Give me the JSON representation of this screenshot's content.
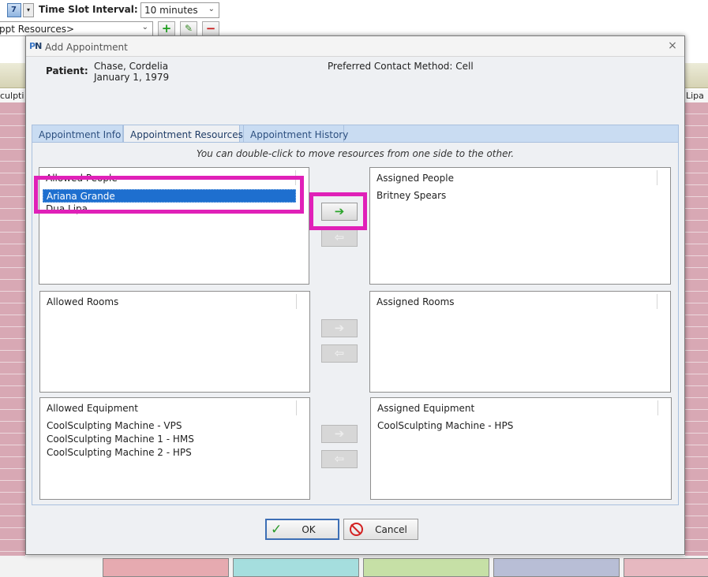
{
  "background": {
    "toolbar": {
      "time_slot_label": "Time Slot Interval:",
      "time_slot_value": "10 minutes",
      "resources_select_value": "ppt Resources>",
      "caret": "⌄",
      "calendar_dropdown": "▾",
      "add_glyph": "+",
      "edit_glyph": "✎",
      "delete_glyph": "−"
    },
    "columns": [
      {
        "label": "culpti",
        "color": "#d8a8b4"
      },
      {
        "label": "Lipa",
        "color": "#d8a8b4"
      }
    ],
    "bottom_bars": [
      "#e6aab0",
      "#a5dede",
      "#c6e0a6",
      "#b8bed6",
      "#e6b8c0"
    ]
  },
  "dialog": {
    "logo": {
      "p": "P",
      "n": "N"
    },
    "title": "Add Appointment",
    "close_glyph": "×",
    "patient": {
      "label": "Patient:",
      "name": "Chase, Cordelia",
      "dob": "January 1, 1979",
      "contact": "Preferred Contact Method: Cell"
    },
    "tabs": [
      {
        "label": "Appointment Info",
        "active": false
      },
      {
        "label": "Appointment Resources",
        "active": true
      },
      {
        "label": "Appointment History",
        "active": false
      }
    ],
    "hint": "You can double-click to move resources from one side to the other.",
    "allowed_people": {
      "header": "Allowed People",
      "items": [
        "Ariana Grande",
        "Dua Lipa"
      ],
      "selected": "Ariana Grande"
    },
    "assigned_people": {
      "header": "Assigned People",
      "items": [
        "Britney Spears"
      ]
    },
    "allowed_rooms": {
      "header": "Allowed Rooms",
      "items": []
    },
    "assigned_rooms": {
      "header": "Assigned Rooms",
      "items": []
    },
    "allowed_equipment": {
      "header": "Allowed Equipment",
      "items": [
        "CoolSculpting Machine - VPS",
        "CoolSculpting Machine 1 - HMS",
        "CoolSculpting Machine 2 - HPS"
      ]
    },
    "assigned_equipment": {
      "header": "Assigned Equipment",
      "items": [
        "CoolSculpting Machine - HPS"
      ]
    },
    "arrows": {
      "right": "➔",
      "left": "⇦"
    },
    "ok_label": "OK",
    "ok_icon": "✓",
    "cancel_label": "Cancel",
    "colors": {
      "highlight": "#e020b8",
      "selection": "#1e6fcf",
      "tab_bg": "#c9dcf2"
    }
  }
}
